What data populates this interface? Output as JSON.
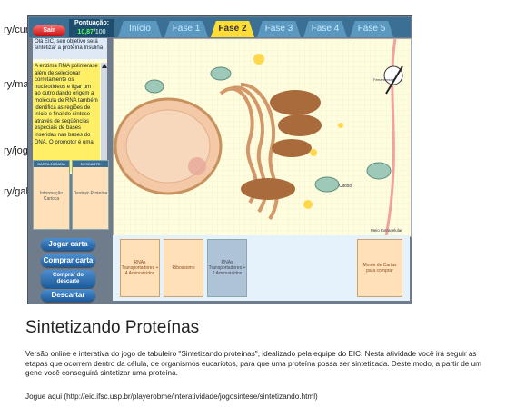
{
  "side_links": [
    "ry/cursos-",
    "ry/material",
    "ry/jogos/)",
    "ry/galeria/)"
  ],
  "game": {
    "exit_label": "Sair",
    "score_label": "Pontuação:",
    "score_value": "10,87",
    "score_total": "/100",
    "tabs": [
      "Início",
      "Fase 1",
      "Fase 2",
      "Fase 3",
      "Fase 4",
      "Fase 5"
    ],
    "active_tab": "Fase 2",
    "objective": "Olá EIC, seu objetivo será sintetizar a proteína Insulina",
    "info_text": "A enzima RNA polimerase além de selecionar corretamente os nucleotídeos e ligar um ao outro dando origem a molécula de RNA também identifica as regiões de início e final de síntese através de seqüências especiais de bases inseridas nas bases do DNA. O promotor é uma",
    "card_panels": [
      {
        "head": "CARTA JOGADA",
        "body": "Informação Carioca"
      },
      {
        "head": "DESCARTE",
        "body": "Destruir Proteína"
      }
    ],
    "scene_labels": {
      "cytosol": "Citosol",
      "extracellular": "Meio Extracelular",
      "ribosome": "Ribossomo",
      "tools": "Ferramentas"
    },
    "buttons": [
      "Jogar carta",
      "Comprar carta",
      "Comprar do descarte",
      "Descartar"
    ],
    "hand_cards": [
      "RNAs Transportadores + 4 Aminoácidos",
      "Ribossomo",
      "RNAs Transportadores + 2 Aminoácidos"
    ],
    "deck_label": "Monte de Cartas para comprar"
  },
  "title": "Sintetizando Proteínas",
  "description": "Versão online e interativa do jogo de tabuleiro \"Sintetizando proteínas\", idealizado pela equipe do EIC. Nesta atividade você irá seguir as etapas que ocorrem dentro da célula, de organismos eucariotos, para que uma proteína possa ser sintetizada. Deste modo, a partir de um gene você conseguirá sintetizar uma proteína.",
  "play_link": "Jogue aqui (http://eic.ifsc.usp.br/playerobme/interatividade/jogosintese/sintetizando.html)"
}
